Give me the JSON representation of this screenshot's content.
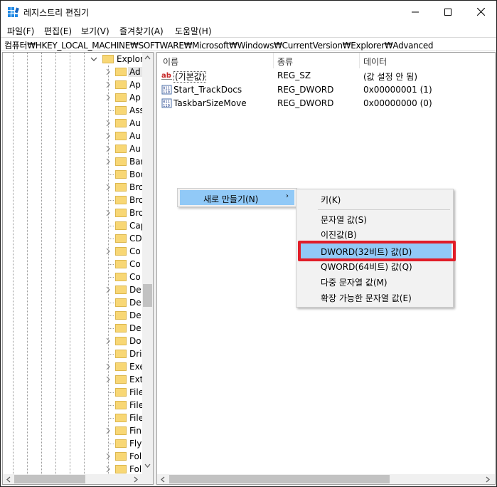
{
  "window": {
    "title": "레지스트리 편집기",
    "min_symbol": "—",
    "max_symbol": "☐",
    "close_symbol": "✕"
  },
  "menu": [
    "파일(F)",
    "편집(E)",
    "보기(V)",
    "즐겨찾기(A)",
    "도움말(H)"
  ],
  "address": "컴퓨터₩HKEY_LOCAL_MACHINE₩SOFTWARE₩Microsoft₩Windows₩CurrentVersion₩Explorer₩Advanced",
  "tree": {
    "parent": "Explorer",
    "items": [
      "Ad",
      "Ap",
      "Ap",
      "Ass",
      "Au",
      "Au",
      "Au",
      "Bar",
      "Boo",
      "Bro",
      "Bro",
      "Bro",
      "Cap",
      "CD",
      "Co",
      "Co",
      "Co",
      "De",
      "De",
      "De",
      "De",
      "Do",
      "Dri",
      "Exe",
      "Ext",
      "File",
      "File",
      "File",
      "Fin",
      "Fly",
      "Fol",
      "Fol"
    ]
  },
  "list": {
    "headers": [
      "이름",
      "종류",
      "데이터"
    ],
    "rows": [
      {
        "name": "(기본값)",
        "type": "REG_SZ",
        "data": "(값 설정 안 됨)",
        "icon": "string-value-icon"
      },
      {
        "name": "Start_TrackDocs",
        "type": "REG_DWORD",
        "data": "0x00000001 (1)",
        "icon": "binary-value-icon"
      },
      {
        "name": "TaskbarSizeMove",
        "type": "REG_DWORD",
        "data": "0x00000000 (0)",
        "icon": "binary-value-icon"
      }
    ]
  },
  "context_menu": {
    "new_label": "새로 만들기(N)",
    "arrow": "›"
  },
  "submenu": {
    "items": [
      "키(K)",
      "문자열 값(S)",
      "이진값(B)",
      "DWORD(32비트) 값(D)",
      "QWORD(64비트) 값(Q)",
      "다중 문자열 값(M)",
      "확장 가능한 문자열 값(E)"
    ],
    "highlighted_index": 3
  },
  "colors": {
    "menu_highlight": "#91c9f7",
    "callout_red": "#e11d28",
    "folder": "#f8d775"
  }
}
